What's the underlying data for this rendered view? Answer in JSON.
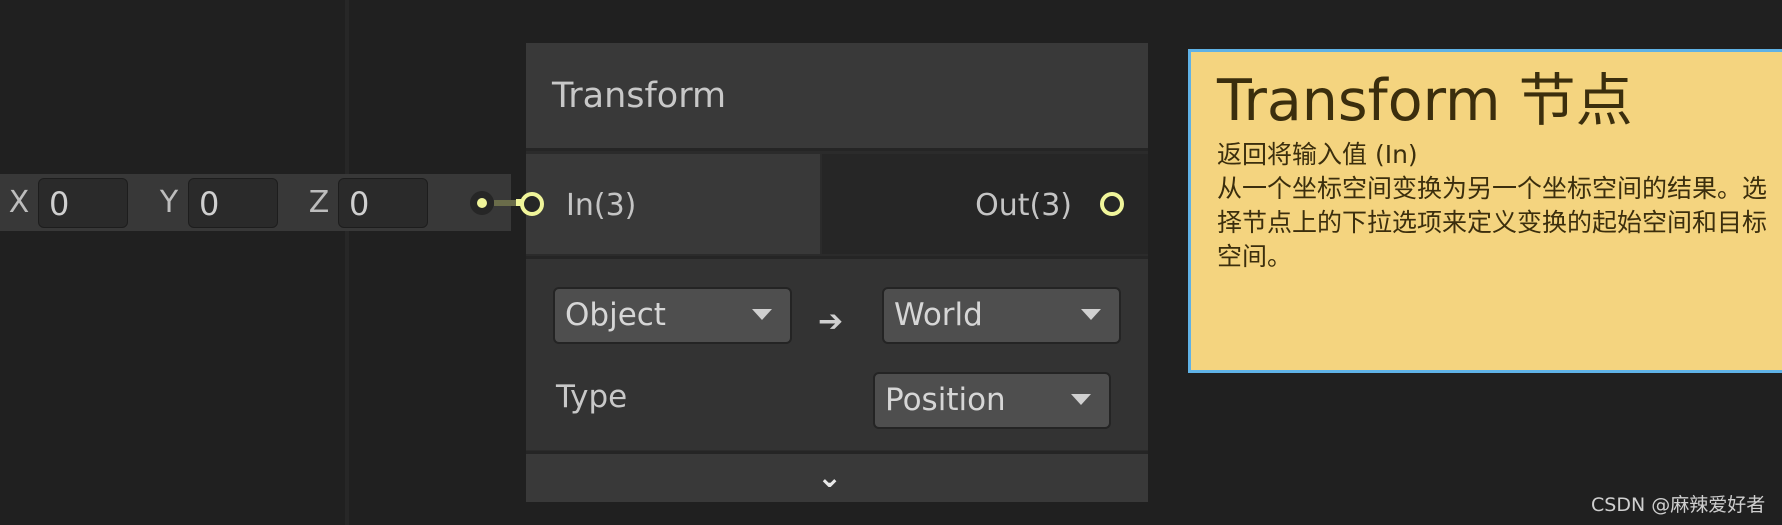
{
  "vector_input": {
    "x_label": "X",
    "x_value": "0",
    "y_label": "Y",
    "y_value": "0",
    "z_label": "Z",
    "z_value": "0"
  },
  "node": {
    "title": "Transform",
    "input_port": "In(3)",
    "output_port": "Out(3)",
    "from_space": "Object",
    "arrow": "➔",
    "to_space": "World",
    "type_label": "Type",
    "type_value": "Position",
    "collapse_icon": "chevron-down-icon"
  },
  "note": {
    "title": "Transform 节点",
    "description": "返回将输入值 (In)\n从一个坐标空间变换为另一个坐标空间的结果。选择节点上的下拉选项来定义变换的起始空间和目标空间。"
  },
  "watermark": "CSDN @麻辣爱好者",
  "colors": {
    "port": "#f0f59a",
    "note_bg": "#f4d47f",
    "note_border": "#5fb2e6"
  }
}
